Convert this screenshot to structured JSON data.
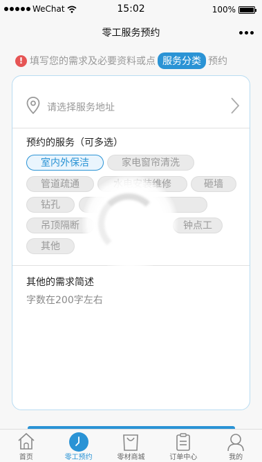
{
  "status_bar": {
    "carrier": "WeChat",
    "time": "15:02",
    "battery": "100%"
  },
  "nav": {
    "title": "零工服务预约"
  },
  "hint": {
    "before": "填写您的需求及必要资料或点",
    "pill": "服务分类",
    "after": "预约"
  },
  "address": {
    "placeholder": "请选择服务地址"
  },
  "services": {
    "title": "预约的服务（可多选）",
    "tags": [
      {
        "label": "室内外保洁",
        "selected": true
      },
      {
        "label": "家电窗帘清洗",
        "selected": false
      },
      {
        "label": "管道疏通",
        "selected": false
      },
      {
        "label": "水电安装维修",
        "selected": false
      },
      {
        "label": "砸墙",
        "selected": false
      },
      {
        "label": "钻孔",
        "selected": false
      },
      {
        "label": "墙砖",
        "selected": false
      },
      {
        "label": "吊顶隔断",
        "selected": false
      },
      {
        "label": "钟点工",
        "selected": false
      },
      {
        "label": "其他",
        "selected": false
      }
    ]
  },
  "notes": {
    "title": "其他的需求简述",
    "placeholder": "字数在200字左右"
  },
  "tabbar": [
    {
      "label": "首页",
      "icon": "home-icon"
    },
    {
      "label": "零工预约",
      "icon": "clock-icon",
      "active": true
    },
    {
      "label": "零材商城",
      "icon": "shopping-bag-icon"
    },
    {
      "label": "订单中心",
      "icon": "clipboard-icon"
    },
    {
      "label": "我的",
      "icon": "user-icon"
    }
  ],
  "colors": {
    "accent": "#2a93d5",
    "warn": "#e65555"
  }
}
